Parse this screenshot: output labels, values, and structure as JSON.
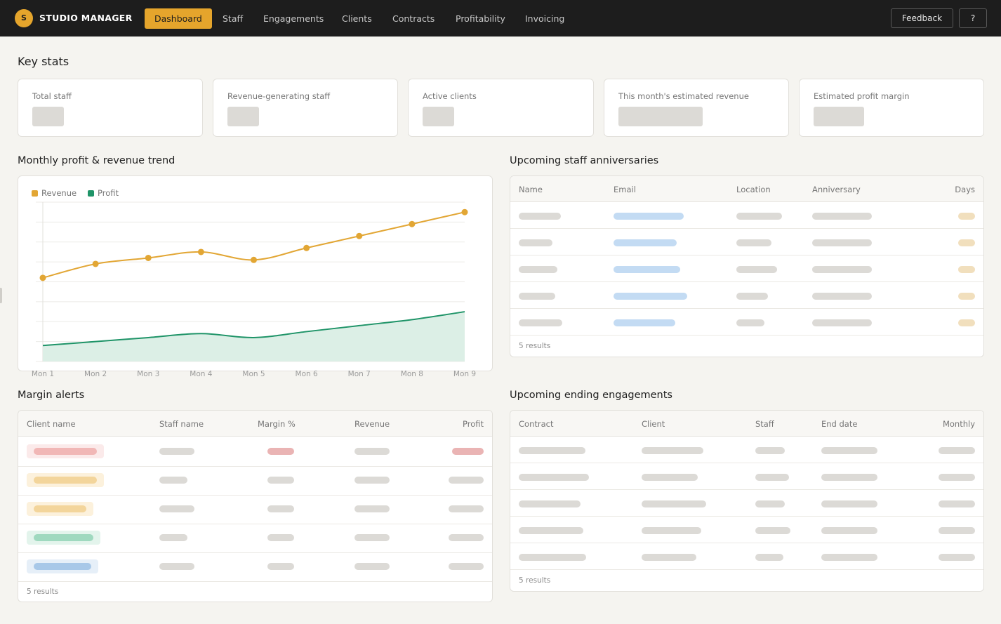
{
  "app": {
    "logo_letter": "S",
    "name": "STUDIO MANAGER"
  },
  "nav": {
    "items": [
      {
        "label": "Dashboard",
        "active": true
      },
      {
        "label": "Staff"
      },
      {
        "label": "Engagements"
      },
      {
        "label": "Clients"
      },
      {
        "label": "Contracts"
      },
      {
        "label": "Profitability"
      },
      {
        "label": "Invoicing"
      }
    ],
    "feedback_label": "Feedback",
    "help_label": "?"
  },
  "key_stats": {
    "title": "Key stats",
    "cards": [
      {
        "label": "Total staff"
      },
      {
        "label": "Revenue-generating staff"
      },
      {
        "label": "Active clients"
      },
      {
        "label": "This month's estimated revenue"
      },
      {
        "label": "Estimated profit margin"
      }
    ]
  },
  "trend": {
    "title": "Monthly profit & revenue trend",
    "legend": {
      "revenue": "Revenue",
      "profit": "Profit"
    },
    "colors": {
      "revenue": "#e2a634",
      "profit": "#1f9468",
      "profit_fill": "#dcefe6"
    }
  },
  "chart_data": {
    "type": "line",
    "title": "",
    "categories": [
      "Mon 1",
      "Mon 2",
      "Mon 3",
      "Mon 4",
      "Mon 5",
      "Mon 6",
      "Mon 7",
      "Mon 8",
      "Mon 9"
    ],
    "series": [
      {
        "name": "Revenue",
        "values": [
          42,
          49,
          52,
          55,
          51,
          57,
          63,
          69,
          75
        ]
      },
      {
        "name": "Profit",
        "values": [
          8,
          10,
          12,
          14,
          12,
          15,
          18,
          21,
          25
        ]
      }
    ],
    "ylim": [
      0,
      80
    ],
    "grid": true,
    "legend": "top-left"
  },
  "anniversaries": {
    "title": "Upcoming staff anniversaries",
    "columns": [
      "Name",
      "Email",
      "Location",
      "Anniversary",
      "Days"
    ],
    "results": "5 results"
  },
  "margin_alerts": {
    "title": "Margin alerts",
    "columns": [
      "Client name",
      "Staff name",
      "Margin %",
      "Revenue",
      "Profit"
    ],
    "results": "5 results",
    "row_colors": [
      "#f1b7b6",
      "#f3d59b",
      "#f3d59b",
      "#9fd9bf",
      "#a8c8e8"
    ],
    "row_tints": [
      "#fbeaea",
      "#fcf1dc",
      "#fcf1dc",
      "#e3f4ec",
      "#e6eff8"
    ]
  },
  "ending_engagements": {
    "title": "Upcoming ending engagements",
    "columns": [
      "Contract",
      "Client",
      "Staff",
      "End date",
      "Monthly"
    ],
    "results": "5 results"
  }
}
